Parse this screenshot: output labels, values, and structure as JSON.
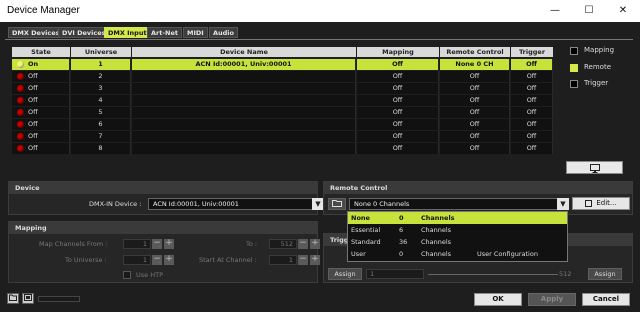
{
  "window": {
    "title": "Device Manager",
    "minimize": "—",
    "maximize": "☐",
    "close": "✕"
  },
  "tabs": [
    "DMX Devices",
    "DVI Devices",
    "DMX Input",
    "Art-Net",
    "MIDI",
    "Audio"
  ],
  "active_tab": "DMX Input",
  "table": {
    "headers": [
      "State",
      "Universe",
      "Device Name",
      "Mapping",
      "Remote Control",
      "Trigger"
    ],
    "rows": [
      {
        "state": "On",
        "universe": "1",
        "device": "ACN Id:00001, Univ:00001",
        "mapping": "Off",
        "remote": "None  0 CH",
        "trigger": "Off",
        "selected": true
      },
      {
        "state": "Off",
        "universe": "2",
        "device": "",
        "mapping": "Off",
        "remote": "Off",
        "trigger": "Off"
      },
      {
        "state": "Off",
        "universe": "3",
        "device": "",
        "mapping": "Off",
        "remote": "Off",
        "trigger": "Off"
      },
      {
        "state": "Off",
        "universe": "4",
        "device": "",
        "mapping": "Off",
        "remote": "Off",
        "trigger": "Off"
      },
      {
        "state": "Off",
        "universe": "5",
        "device": "",
        "mapping": "Off",
        "remote": "Off",
        "trigger": "Off"
      },
      {
        "state": "Off",
        "universe": "6",
        "device": "",
        "mapping": "Off",
        "remote": "Off",
        "trigger": "Off"
      },
      {
        "state": "Off",
        "universe": "7",
        "device": "",
        "mapping": "Off",
        "remote": "Off",
        "trigger": "Off"
      },
      {
        "state": "Off",
        "universe": "8",
        "device": "",
        "mapping": "Off",
        "remote": "Off",
        "trigger": "Off"
      }
    ]
  },
  "legend": [
    "Mapping",
    "Remote",
    "Trigger"
  ],
  "monitor_icon": "monitor-icon",
  "device_panel": {
    "title": "Device",
    "label": "DMX-IN Device :",
    "value": "ACN Id:00001, Univ:00001"
  },
  "remote_panel": {
    "title": "Remote Control",
    "value": "None   0 Channels",
    "edit": "Edit..."
  },
  "dropdown": [
    {
      "name": "None",
      "count": "0",
      "unit": "Channels",
      "extra": ""
    },
    {
      "name": "Essential",
      "count": "6",
      "unit": "Channels",
      "extra": ""
    },
    {
      "name": "Standard",
      "count": "36",
      "unit": "Channels",
      "extra": ""
    },
    {
      "name": "User",
      "count": "0",
      "unit": "Channels",
      "extra": "User Configuration"
    }
  ],
  "mapping_panel": {
    "title": "Mapping",
    "map_from": "Map Channels From :",
    "map_from_val": "1",
    "to": "To :",
    "to_val": "512",
    "to_universe": "To Universe :",
    "to_universe_val": "1",
    "start_ch": "Start At Channel :",
    "start_ch_val": "1",
    "use_htp": "Use HTP"
  },
  "trigger_panel": {
    "title": "Trigg",
    "assign": "Assign",
    "val_left": "1",
    "val_right": "512"
  },
  "footer": {
    "ok": "OK",
    "apply": "Apply",
    "cancel": "Cancel"
  }
}
